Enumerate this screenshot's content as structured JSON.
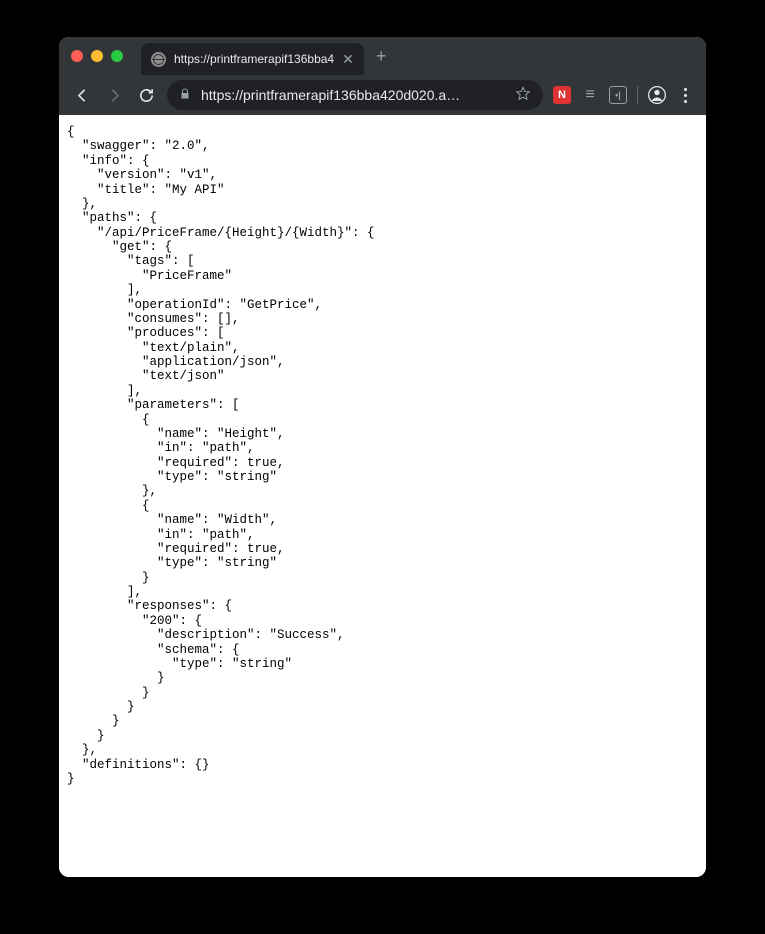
{
  "tab": {
    "title": "https://printframerapif136bba4",
    "close": "✕"
  },
  "newtab": "+",
  "address": {
    "url": "https://printframerapif136bba420d020.a…"
  },
  "extensions": {
    "ext1": "N",
    "buffer": "≡",
    "lastpass": "•|"
  },
  "json_text": "{\n  \"swagger\": \"2.0\",\n  \"info\": {\n    \"version\": \"v1\",\n    \"title\": \"My API\"\n  },\n  \"paths\": {\n    \"/api/PriceFrame/{Height}/{Width}\": {\n      \"get\": {\n        \"tags\": [\n          \"PriceFrame\"\n        ],\n        \"operationId\": \"GetPrice\",\n        \"consumes\": [],\n        \"produces\": [\n          \"text/plain\",\n          \"application/json\",\n          \"text/json\"\n        ],\n        \"parameters\": [\n          {\n            \"name\": \"Height\",\n            \"in\": \"path\",\n            \"required\": true,\n            \"type\": \"string\"\n          },\n          {\n            \"name\": \"Width\",\n            \"in\": \"path\",\n            \"required\": true,\n            \"type\": \"string\"\n          }\n        ],\n        \"responses\": {\n          \"200\": {\n            \"description\": \"Success\",\n            \"schema\": {\n              \"type\": \"string\"\n            }\n          }\n        }\n      }\n    }\n  },\n  \"definitions\": {}\n}"
}
